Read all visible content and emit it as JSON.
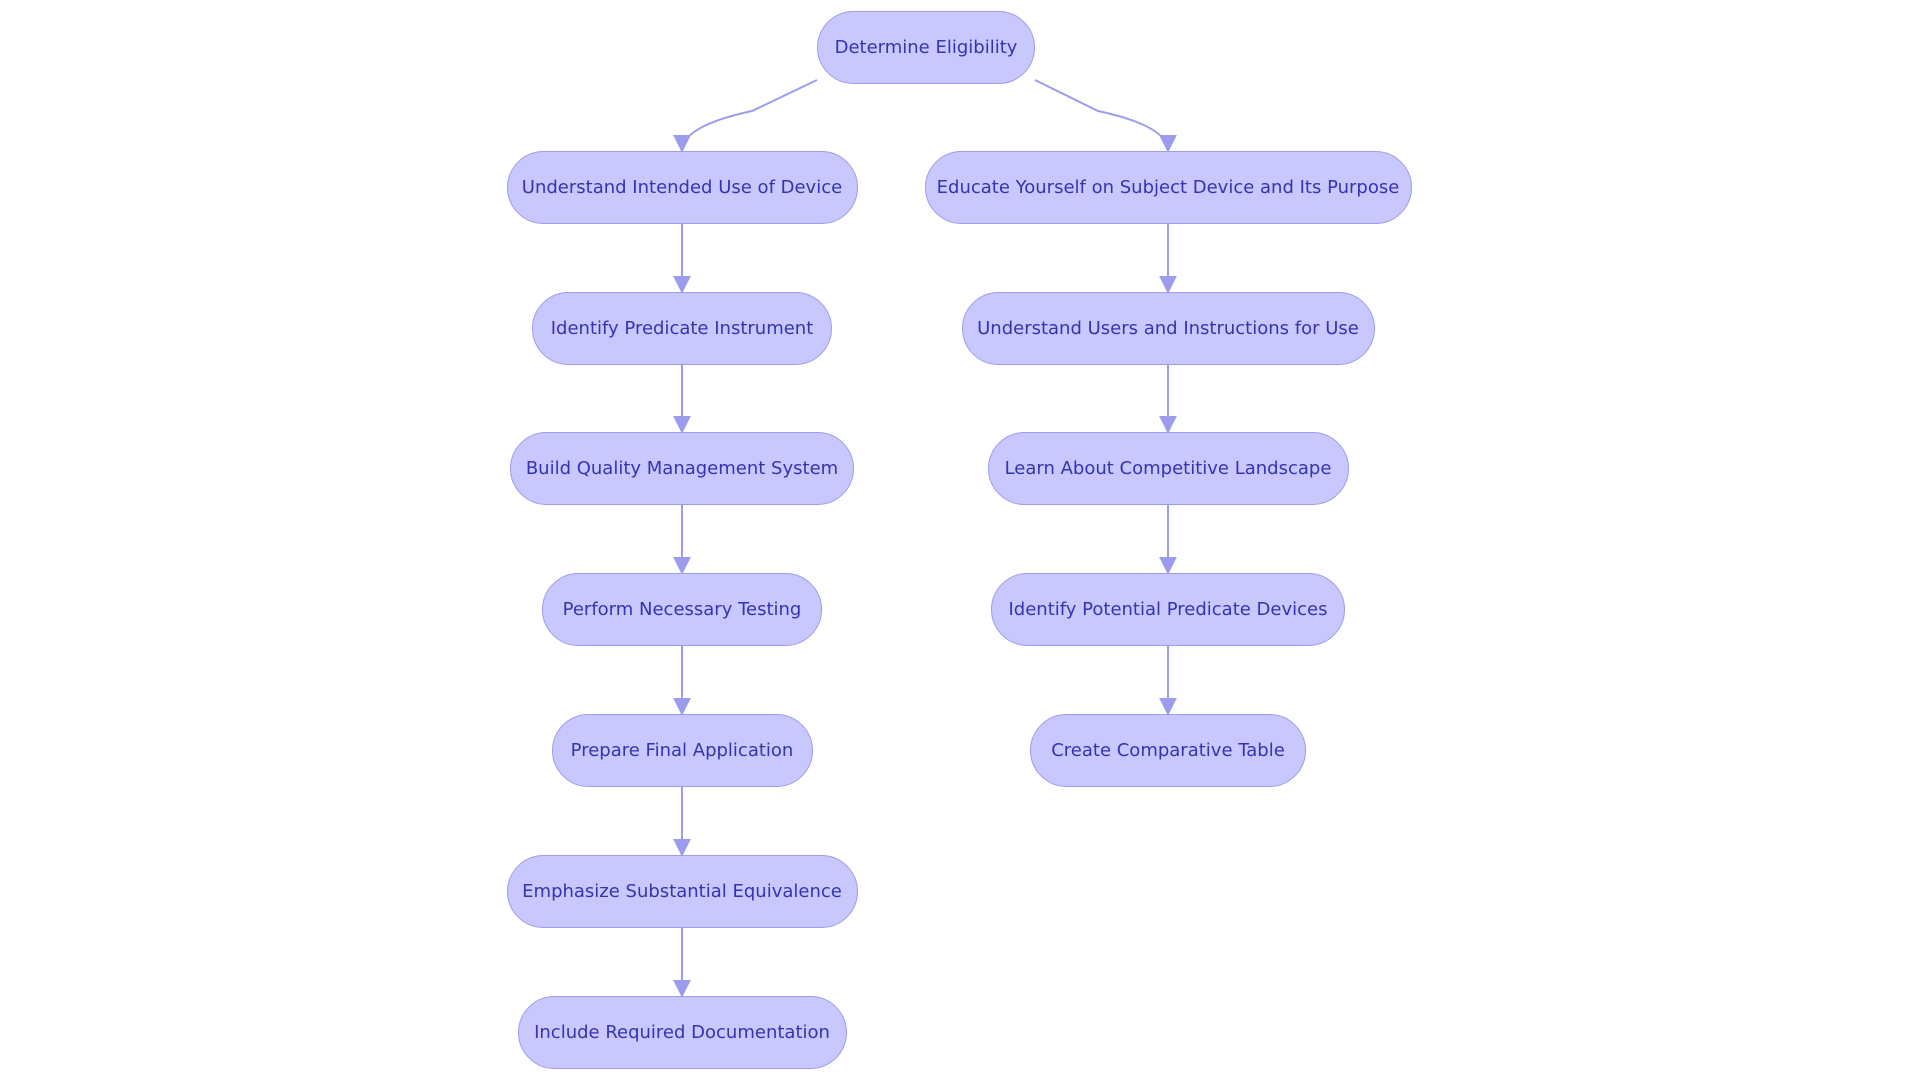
{
  "colors": {
    "node_fill": "#c8c8ff",
    "node_border": "#9c9cee",
    "node_text": "#3434b0",
    "edge": "#9c9cee"
  },
  "root": {
    "id": "root",
    "label": "Determine Eligibility"
  },
  "left_branch": [
    {
      "id": "l1",
      "label": "Understand Intended Use of Device"
    },
    {
      "id": "l2",
      "label": "Identify Predicate Instrument"
    },
    {
      "id": "l3",
      "label": "Build Quality Management System"
    },
    {
      "id": "l4",
      "label": "Perform Necessary Testing"
    },
    {
      "id": "l5",
      "label": "Prepare Final Application"
    },
    {
      "id": "l6",
      "label": "Emphasize Substantial Equivalence"
    },
    {
      "id": "l7",
      "label": "Include Required Documentation"
    }
  ],
  "right_branch": [
    {
      "id": "r1",
      "label": "Educate Yourself on Subject Device and Its Purpose"
    },
    {
      "id": "r2",
      "label": "Understand Users and Instructions for Use"
    },
    {
      "id": "r3",
      "label": "Learn About Competitive Landscape"
    },
    {
      "id": "r4",
      "label": "Identify Potential Predicate Devices"
    },
    {
      "id": "r5",
      "label": "Create Comparative Table"
    }
  ],
  "edges": [
    [
      "root",
      "l1"
    ],
    [
      "l1",
      "l2"
    ],
    [
      "l2",
      "l3"
    ],
    [
      "l3",
      "l4"
    ],
    [
      "l4",
      "l5"
    ],
    [
      "l5",
      "l6"
    ],
    [
      "l6",
      "l7"
    ],
    [
      "root",
      "r1"
    ],
    [
      "r1",
      "r2"
    ],
    [
      "r2",
      "r3"
    ],
    [
      "r3",
      "r4"
    ],
    [
      "r4",
      "r5"
    ]
  ]
}
